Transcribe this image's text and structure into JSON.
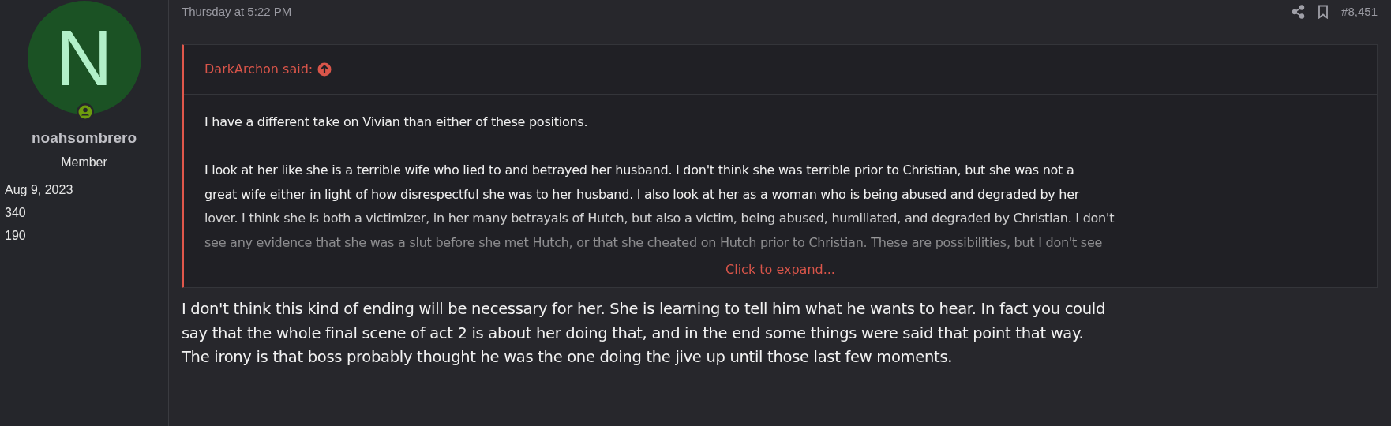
{
  "author": {
    "avatar_letter": "N",
    "username": "noahsombrero",
    "title": "Member",
    "joined": "Aug 9, 2023",
    "stat_1": "340",
    "stat_2": "190"
  },
  "post": {
    "time": "Thursday at 5:22 PM",
    "number": "#8,451",
    "quote": {
      "header": "DarkArchon said:",
      "paragraphs": [
        [
          "I have a different take on Vivian than either of these positions."
        ],
        [
          "I look at her like she is a terrible wife who lied to and betrayed her husband. I don't think she was terrible prior to Christian, but she was not a",
          "great wife either in light of how disrespectful she was to her husband. I also look at her as a woman who is being abused and degraded by her",
          "lover. I think she is both a victimizer, in her many betrayals of Hutch, but also a victim, being abused, humiliated, and degraded by Christian. I don't",
          "see any evidence that she was a slut before she met Hutch, or that she cheated on Hutch prior to Christian. These are possibilities, but I don't see"
        ]
      ],
      "expand": "Click to expand..."
    },
    "body_lines": [
      "I don't think this kind of ending will be necessary for her. She is learning to tell him what he wants to hear. In fact you could",
      "say that the whole final scene of act 2 is about her doing that, and in the end some things were said that point that way.",
      "The irony is that boss probably thought he was the one doing the jive up until those last few moments."
    ]
  }
}
